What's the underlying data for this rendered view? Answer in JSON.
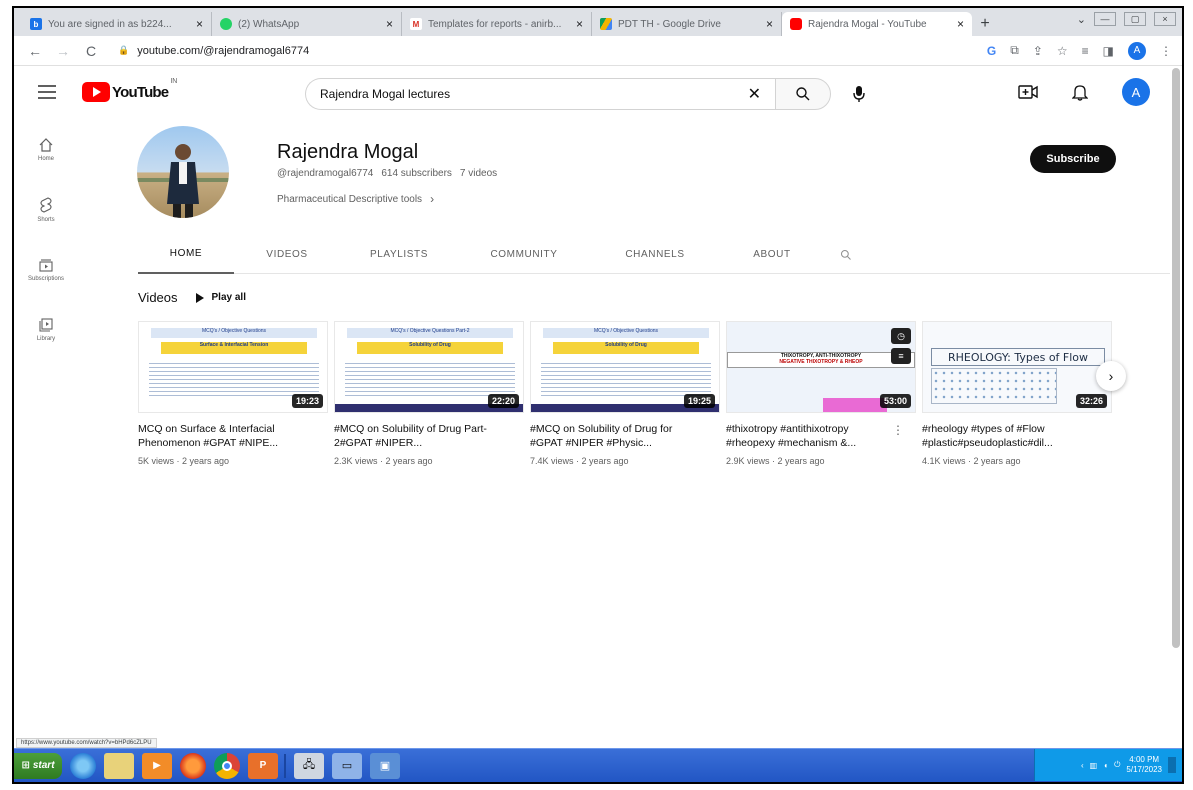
{
  "browser": {
    "tabs": [
      {
        "title": "You are signed in as b224...",
        "fav_color": "#1a73e8",
        "fav_letter": "b"
      },
      {
        "title": "(2) WhatsApp",
        "fav_color": "#25d366",
        "fav_letter": ""
      },
      {
        "title": "Templates for reports - anirb...",
        "fav_color": "#d93025",
        "fav_letter": "M"
      },
      {
        "title": "PDT TH - Google Drive",
        "fav_color": "#f4b400",
        "fav_letter": ""
      },
      {
        "title": "Rajendra Mogal - YouTube",
        "fav_color": "#ff0000",
        "fav_letter": ""
      }
    ],
    "url": "youtube.com/@rajendramogal6774"
  },
  "masthead": {
    "logo_text": "YouTube",
    "logo_suffix": "IN",
    "search_value": "Rajendra Mogal lectures",
    "avatar_letter": "A"
  },
  "guide": [
    {
      "label": "Home",
      "icon": "home-icon"
    },
    {
      "label": "Shorts",
      "icon": "shorts-icon"
    },
    {
      "label": "Subscriptions",
      "icon": "subscriptions-icon"
    },
    {
      "label": "Library",
      "icon": "library-icon"
    }
  ],
  "channel": {
    "name": "Rajendra Mogal",
    "handle": "@rajendramogal6774",
    "subscribers": "614 subscribers",
    "videos_count": "7 videos",
    "description": "Pharmaceutical Descriptive tools",
    "subscribe_label": "Subscribe"
  },
  "channel_tabs": [
    "HOME",
    "VIDEOS",
    "PLAYLISTS",
    "COMMUNITY",
    "CHANNELS",
    "ABOUT"
  ],
  "shelf": {
    "title": "Videos",
    "play_all": "Play all",
    "videos": [
      {
        "title": "MCQ on Surface & Interfacial Phenomenon #GPAT #NIPE...",
        "meta": "5K views · 2 years ago",
        "duration": "19:23",
        "thumb_header": "MCQ's / Objective Questions",
        "thumb_sub": "Surface & Interfacial Tension"
      },
      {
        "title": "#MCQ on Solubility of Drug Part-2#GPAT #NIPER...",
        "meta": "2.3K views · 2 years ago",
        "duration": "22:20",
        "thumb_header": "MCQ's / Objective Questions Part-2",
        "thumb_sub": "Solubility of Drug"
      },
      {
        "title": "#MCQ on Solubility of Drug for #GPAT #NIPER #Physic...",
        "meta": "7.4K views · 2 years ago",
        "duration": "19:25",
        "thumb_header": "MCQ's / Objective Questions",
        "thumb_sub": "Solubility of Drug"
      },
      {
        "title": "#thixotropy #antithixotropy #rheopexy #mechanism &...",
        "meta": "2.9K views · 2 years ago",
        "duration": "53:00",
        "thumb_header": "THIXOTROPY, ANTI-THIXOTROPY",
        "thumb_sub": "NEGATIVE THIXOTROPY & RHEOP"
      },
      {
        "title": "#rheology #types of #Flow #plastic#pseudoplastic#dil...",
        "meta": "4.1K views · 2 years ago",
        "duration": "32:26",
        "thumb_header": "RHEOLOGY: Types of Flow",
        "thumb_sub": ""
      }
    ]
  },
  "statusbar_url": "https://www.youtube.com/watch?v=bHPd6cZLPU",
  "taskbar": {
    "start_label": "start",
    "clock_time": "4:00 PM",
    "clock_date": "5/17/2023"
  }
}
